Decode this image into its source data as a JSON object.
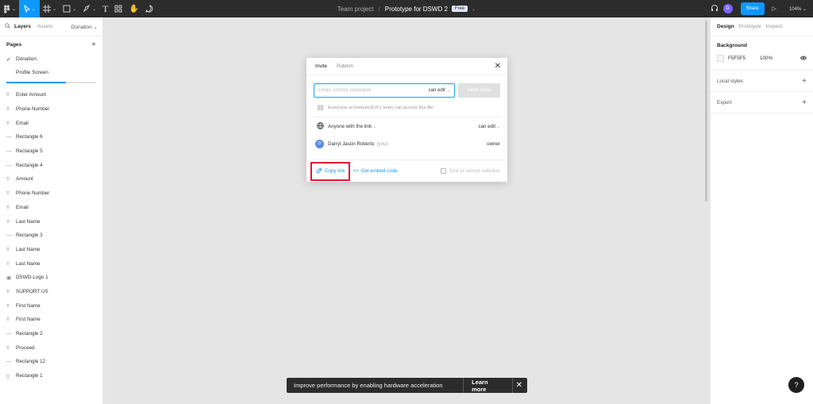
{
  "toolbar": {
    "icons": [
      "figma-menu-icon",
      "move-tool-icon",
      "frame-tool-icon",
      "shape-tool-icon",
      "pen-tool-icon",
      "text-tool-icon",
      "resources-icon",
      "hand-tool-icon",
      "comment-tool-icon"
    ],
    "team": "Team project",
    "separator": "/",
    "file_name": "Prototype for DSWD 2",
    "badge": "Free",
    "avatar_initial": "D",
    "share_label": "Share",
    "zoom": "104%"
  },
  "left_panel": {
    "tabs": [
      "Layers",
      "Assets"
    ],
    "page_dropdown": "Donation",
    "pages_title": "Pages",
    "pages": [
      "Donation",
      "Profile Screen"
    ],
    "layers": [
      {
        "icon": "T",
        "name": "Enter Amount"
      },
      {
        "icon": "T",
        "name": "Phone Number"
      },
      {
        "icon": "T",
        "name": "Email"
      },
      {
        "icon": "—",
        "name": "Rectangle 6"
      },
      {
        "icon": "—",
        "name": "Rectangle 5"
      },
      {
        "icon": "—",
        "name": "Rectangle 4"
      },
      {
        "icon": "T",
        "name": "Amount"
      },
      {
        "icon": "T",
        "name": "Phone Number"
      },
      {
        "icon": "T",
        "name": "Email"
      },
      {
        "icon": "T",
        "name": "Last Name"
      },
      {
        "icon": "—",
        "name": "Rectangle 3"
      },
      {
        "icon": "T",
        "name": "Last Name"
      },
      {
        "icon": "T",
        "name": "Last Name"
      },
      {
        "icon": "▣",
        "name": "DSWD-Logo 1"
      },
      {
        "icon": "T",
        "name": "SUPPORT US"
      },
      {
        "icon": "T",
        "name": "First Name"
      },
      {
        "icon": "T",
        "name": "First Name"
      },
      {
        "icon": "—",
        "name": "Rectangle 2"
      },
      {
        "icon": "T",
        "name": "Proceed"
      },
      {
        "icon": "—",
        "name": "Rectangle 12"
      },
      {
        "icon": "▯",
        "name": "Rectangle 1"
      }
    ]
  },
  "right_panel": {
    "tabs": [
      "Design",
      "Prototype",
      "Inspect"
    ],
    "background_title": "Background",
    "background_hex": "F5F5F5",
    "background_opacity": "100%",
    "local_styles": "Local styles",
    "export": "Export"
  },
  "modal": {
    "tabs": [
      "Invite",
      "Publish"
    ],
    "email_placeholder": "Email, comma separated",
    "invite_permission": "can edit",
    "send_label": "Send invite",
    "team_access_text": "Everyone at honkairoll15's team can access this file.",
    "link_access_label": "Anyone with the link",
    "link_permission": "can edit",
    "user_initial": "D",
    "user_name": "Darryl Jason Roberto",
    "user_you": "(you)",
    "user_role": "owner",
    "copy_link": "Copy link",
    "embed_code": "Get embed code",
    "link_current": "Link to current selection"
  },
  "toast": {
    "message": "Improve performance by enabling hardware acceleration",
    "learn_more": "Learn more"
  },
  "help_label": "?",
  "colors": {
    "accent": "#0d99ff",
    "highlight": "#e8112d",
    "toolbar_bg": "#2c2c2c"
  }
}
